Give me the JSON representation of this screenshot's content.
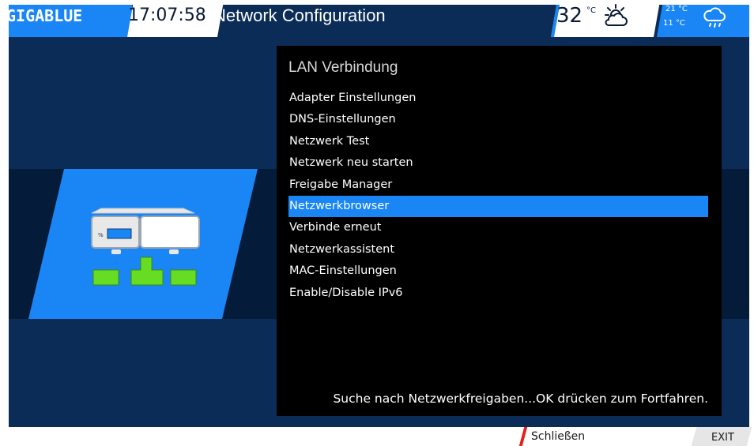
{
  "header": {
    "logo": "GIGABLUE",
    "time": "17:07:58",
    "title": "Network Configuration",
    "temperature": "32",
    "temperature_unit": "°C",
    "forecast_high": "21 °C",
    "forecast_low": "11 °C",
    "current_weather_icon": "sun-cloud-icon",
    "forecast_weather_icon": "rain-cloud-icon"
  },
  "menu": {
    "title": "LAN Verbindung",
    "items": [
      {
        "label": "Adapter Einstellungen"
      },
      {
        "label": "DNS-Einstellungen"
      },
      {
        "label": "Netzwerk Test"
      },
      {
        "label": "Netzwerk neu starten"
      },
      {
        "label": "Freigabe Manager"
      },
      {
        "label": "Netzwerkbrowser"
      },
      {
        "label": "Verbinde erneut"
      },
      {
        "label": "Netzwerkassistent"
      },
      {
        "label": "MAC-Einstellungen"
      },
      {
        "label": "Enable/Disable IPv6"
      }
    ],
    "selected_index": 5,
    "status": "Suche nach Netzwerkfreigaben...OK drücken zum Fortfahren."
  },
  "footer": {
    "red_key_label": "Schließen",
    "exit_label": "EXIT"
  },
  "colors": {
    "accent": "#1a86f5",
    "background": "#0a2c57",
    "band": "#051b3a",
    "panel": "#000000",
    "device_green": "#66dd22",
    "red_key": "#e0231a"
  }
}
